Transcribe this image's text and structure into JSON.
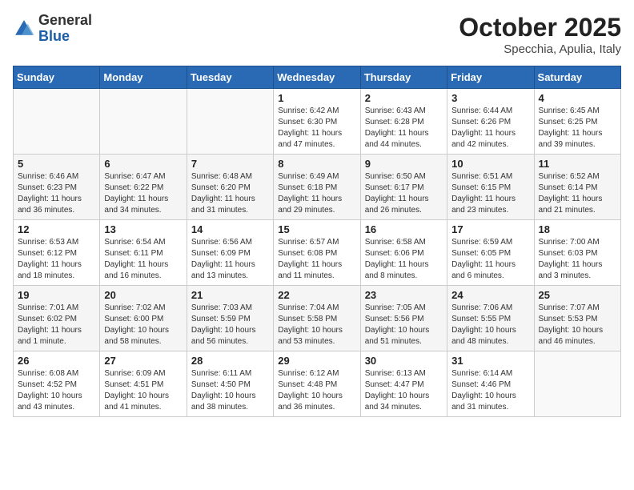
{
  "header": {
    "logo_general": "General",
    "logo_blue": "Blue",
    "month": "October 2025",
    "location": "Specchia, Apulia, Italy"
  },
  "days_of_week": [
    "Sunday",
    "Monday",
    "Tuesday",
    "Wednesday",
    "Thursday",
    "Friday",
    "Saturday"
  ],
  "weeks": [
    {
      "shaded": false,
      "days": [
        {
          "num": "",
          "info": ""
        },
        {
          "num": "",
          "info": ""
        },
        {
          "num": "",
          "info": ""
        },
        {
          "num": "1",
          "info": "Sunrise: 6:42 AM\nSunset: 6:30 PM\nDaylight: 11 hours\nand 47 minutes."
        },
        {
          "num": "2",
          "info": "Sunrise: 6:43 AM\nSunset: 6:28 PM\nDaylight: 11 hours\nand 44 minutes."
        },
        {
          "num": "3",
          "info": "Sunrise: 6:44 AM\nSunset: 6:26 PM\nDaylight: 11 hours\nand 42 minutes."
        },
        {
          "num": "4",
          "info": "Sunrise: 6:45 AM\nSunset: 6:25 PM\nDaylight: 11 hours\nand 39 minutes."
        }
      ]
    },
    {
      "shaded": true,
      "days": [
        {
          "num": "5",
          "info": "Sunrise: 6:46 AM\nSunset: 6:23 PM\nDaylight: 11 hours\nand 36 minutes."
        },
        {
          "num": "6",
          "info": "Sunrise: 6:47 AM\nSunset: 6:22 PM\nDaylight: 11 hours\nand 34 minutes."
        },
        {
          "num": "7",
          "info": "Sunrise: 6:48 AM\nSunset: 6:20 PM\nDaylight: 11 hours\nand 31 minutes."
        },
        {
          "num": "8",
          "info": "Sunrise: 6:49 AM\nSunset: 6:18 PM\nDaylight: 11 hours\nand 29 minutes."
        },
        {
          "num": "9",
          "info": "Sunrise: 6:50 AM\nSunset: 6:17 PM\nDaylight: 11 hours\nand 26 minutes."
        },
        {
          "num": "10",
          "info": "Sunrise: 6:51 AM\nSunset: 6:15 PM\nDaylight: 11 hours\nand 23 minutes."
        },
        {
          "num": "11",
          "info": "Sunrise: 6:52 AM\nSunset: 6:14 PM\nDaylight: 11 hours\nand 21 minutes."
        }
      ]
    },
    {
      "shaded": false,
      "days": [
        {
          "num": "12",
          "info": "Sunrise: 6:53 AM\nSunset: 6:12 PM\nDaylight: 11 hours\nand 18 minutes."
        },
        {
          "num": "13",
          "info": "Sunrise: 6:54 AM\nSunset: 6:11 PM\nDaylight: 11 hours\nand 16 minutes."
        },
        {
          "num": "14",
          "info": "Sunrise: 6:56 AM\nSunset: 6:09 PM\nDaylight: 11 hours\nand 13 minutes."
        },
        {
          "num": "15",
          "info": "Sunrise: 6:57 AM\nSunset: 6:08 PM\nDaylight: 11 hours\nand 11 minutes."
        },
        {
          "num": "16",
          "info": "Sunrise: 6:58 AM\nSunset: 6:06 PM\nDaylight: 11 hours\nand 8 minutes."
        },
        {
          "num": "17",
          "info": "Sunrise: 6:59 AM\nSunset: 6:05 PM\nDaylight: 11 hours\nand 6 minutes."
        },
        {
          "num": "18",
          "info": "Sunrise: 7:00 AM\nSunset: 6:03 PM\nDaylight: 11 hours\nand 3 minutes."
        }
      ]
    },
    {
      "shaded": true,
      "days": [
        {
          "num": "19",
          "info": "Sunrise: 7:01 AM\nSunset: 6:02 PM\nDaylight: 11 hours\nand 1 minute."
        },
        {
          "num": "20",
          "info": "Sunrise: 7:02 AM\nSunset: 6:00 PM\nDaylight: 10 hours\nand 58 minutes."
        },
        {
          "num": "21",
          "info": "Sunrise: 7:03 AM\nSunset: 5:59 PM\nDaylight: 10 hours\nand 56 minutes."
        },
        {
          "num": "22",
          "info": "Sunrise: 7:04 AM\nSunset: 5:58 PM\nDaylight: 10 hours\nand 53 minutes."
        },
        {
          "num": "23",
          "info": "Sunrise: 7:05 AM\nSunset: 5:56 PM\nDaylight: 10 hours\nand 51 minutes."
        },
        {
          "num": "24",
          "info": "Sunrise: 7:06 AM\nSunset: 5:55 PM\nDaylight: 10 hours\nand 48 minutes."
        },
        {
          "num": "25",
          "info": "Sunrise: 7:07 AM\nSunset: 5:53 PM\nDaylight: 10 hours\nand 46 minutes."
        }
      ]
    },
    {
      "shaded": false,
      "days": [
        {
          "num": "26",
          "info": "Sunrise: 6:08 AM\nSunset: 4:52 PM\nDaylight: 10 hours\nand 43 minutes."
        },
        {
          "num": "27",
          "info": "Sunrise: 6:09 AM\nSunset: 4:51 PM\nDaylight: 10 hours\nand 41 minutes."
        },
        {
          "num": "28",
          "info": "Sunrise: 6:11 AM\nSunset: 4:50 PM\nDaylight: 10 hours\nand 38 minutes."
        },
        {
          "num": "29",
          "info": "Sunrise: 6:12 AM\nSunset: 4:48 PM\nDaylight: 10 hours\nand 36 minutes."
        },
        {
          "num": "30",
          "info": "Sunrise: 6:13 AM\nSunset: 4:47 PM\nDaylight: 10 hours\nand 34 minutes."
        },
        {
          "num": "31",
          "info": "Sunrise: 6:14 AM\nSunset: 4:46 PM\nDaylight: 10 hours\nand 31 minutes."
        },
        {
          "num": "",
          "info": ""
        }
      ]
    }
  ]
}
